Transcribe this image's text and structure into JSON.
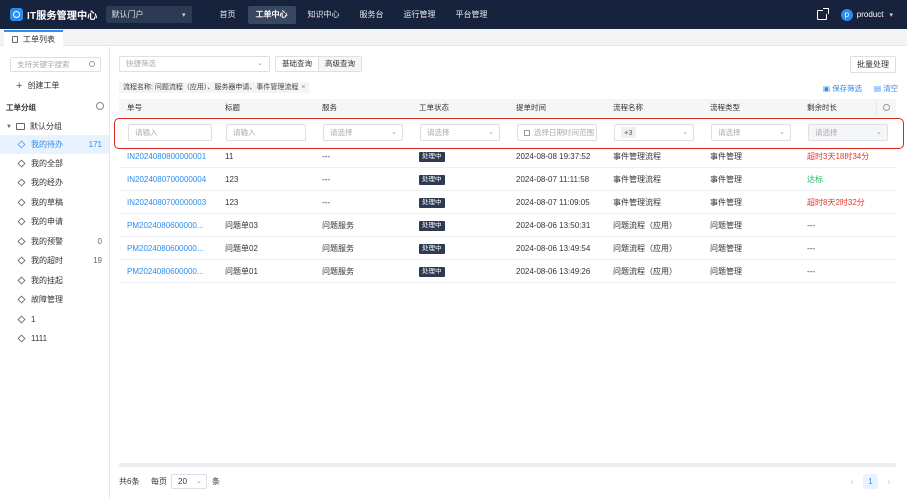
{
  "topbar": {
    "app_title": "IT服务管理中心",
    "portal_value": "默认门户",
    "menu": [
      "首页",
      "工单中心",
      "知识中心",
      "服务台",
      "运行管理",
      "平台管理"
    ],
    "active_menu": "工单中心",
    "user_initial": "p",
    "user_name": "product"
  },
  "tabs": {
    "active_label": "工单列表"
  },
  "sidebar": {
    "search_placeholder": "支持关键字搜索",
    "create_label": "创建工单",
    "section_title": "工单分组",
    "group_label": "默认分组",
    "items": [
      {
        "label": "我的待办",
        "count": "171",
        "active": true
      },
      {
        "label": "我的全部",
        "count": ""
      },
      {
        "label": "我的经办",
        "count": ""
      },
      {
        "label": "我的草稿",
        "count": ""
      },
      {
        "label": "我的申请",
        "count": ""
      },
      {
        "label": "我的预警",
        "count": "0"
      },
      {
        "label": "我的超时",
        "count": "19"
      },
      {
        "label": "我的挂起",
        "count": ""
      },
      {
        "label": "故障管理",
        "count": ""
      },
      {
        "label": "1",
        "count": ""
      },
      {
        "label": "1111",
        "count": ""
      }
    ]
  },
  "toolbar": {
    "quick_filter_placeholder": "快捷筛选",
    "basic_query": "基础查询",
    "advanced_query": "高级查询",
    "batch_button": "批量处理",
    "condition_tag": "流程名称: 问题流程（应用）、服务器申请、事件管理流程",
    "save_filter": "保存筛选",
    "clear_filter": "清空"
  },
  "table": {
    "headers": [
      "单号",
      "标题",
      "服务",
      "工单状态",
      "提单时间",
      "流程名称",
      "流程类型",
      "剩余时长"
    ],
    "filters": {
      "input_placeholder": "请输入",
      "select_placeholder": "请选择",
      "date_placeholder": "选择日期时间范围",
      "process_tag": "+3"
    },
    "rows": [
      {
        "id": "IN2024080800000001",
        "title": "11",
        "service": "---",
        "status": "处理中",
        "time": "2024-08-08 19:37:52",
        "process": "事件管理流程",
        "type": "事件管理",
        "remain": "超时3天18时34分",
        "remain_color": "#e8342b"
      },
      {
        "id": "IN2024080700000004",
        "title": "123",
        "service": "---",
        "status": "处理中",
        "time": "2024-08-07 11:11:58",
        "process": "事件管理流程",
        "type": "事件管理",
        "remain": "达标",
        "remain_color": "#19be6b"
      },
      {
        "id": "IN2024080700000003",
        "title": "123",
        "service": "---",
        "status": "处理中",
        "time": "2024-08-07 11:09:05",
        "process": "事件管理流程",
        "type": "事件管理",
        "remain": "超时8天2时32分",
        "remain_color": "#e8342b"
      },
      {
        "id": "PM2024080600000...",
        "title": "问题单03",
        "service": "问题服务",
        "status": "处理中",
        "time": "2024-08-06 13:50:31",
        "process": "问题流程（应用）",
        "type": "问题管理",
        "remain": "---",
        "remain_color": "#333333"
      },
      {
        "id": "PM2024080600000...",
        "title": "问题单02",
        "service": "问题服务",
        "status": "处理中",
        "time": "2024-08-06 13:49:54",
        "process": "问题流程（应用）",
        "type": "问题管理",
        "remain": "---",
        "remain_color": "#333333"
      },
      {
        "id": "PM2024080600000...",
        "title": "问题单01",
        "service": "问题服务",
        "status": "处理中",
        "time": "2024-08-06 13:49:26",
        "process": "问题流程（应用）",
        "type": "问题管理",
        "remain": "---",
        "remain_color": "#333333"
      }
    ]
  },
  "footer": {
    "total": "共6条",
    "per_page_label": "每页",
    "page_size": "20",
    "unit": "条",
    "current_page": "1"
  },
  "colors": {
    "nav_bg": "#17233d",
    "accent": "#2d8cf0",
    "highlight_border": "#d9261c"
  }
}
